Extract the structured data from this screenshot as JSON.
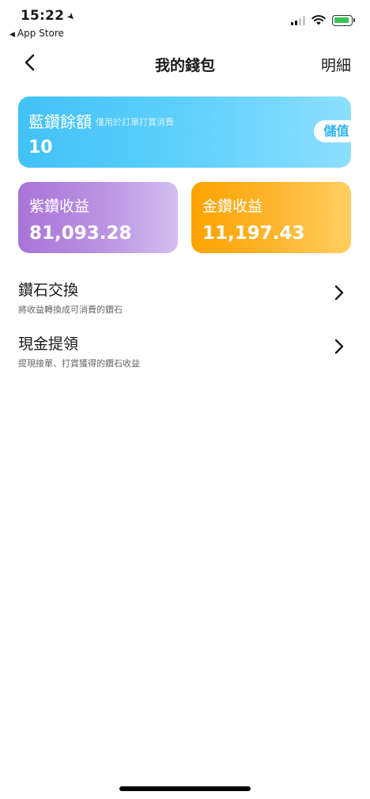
{
  "status_bar": {
    "time": "15:22",
    "back_app": "App Store"
  },
  "nav": {
    "title": "我的錢包",
    "detail_label": "明細"
  },
  "blue_card": {
    "title": "藍鑽餘額",
    "note": "僅用於訂單打賞消費",
    "value": "10",
    "button_label": "儲值",
    "color": "#41c1f7"
  },
  "purple_card": {
    "title": "紫鑽收益",
    "value": "81,093.28",
    "color": "#a873d8"
  },
  "gold_card": {
    "title": "金鑽收益",
    "value": "11,197.43",
    "color": "#fca300"
  },
  "menu": [
    {
      "title": "鑽石交換",
      "subtitle": "將收益轉換成可消費的鑽石",
      "icon": "chevron-right-icon"
    },
    {
      "title": "現金提領",
      "subtitle": "提現接單、打賞獲得的鑽石收益",
      "icon": "chevron-right-icon"
    }
  ]
}
